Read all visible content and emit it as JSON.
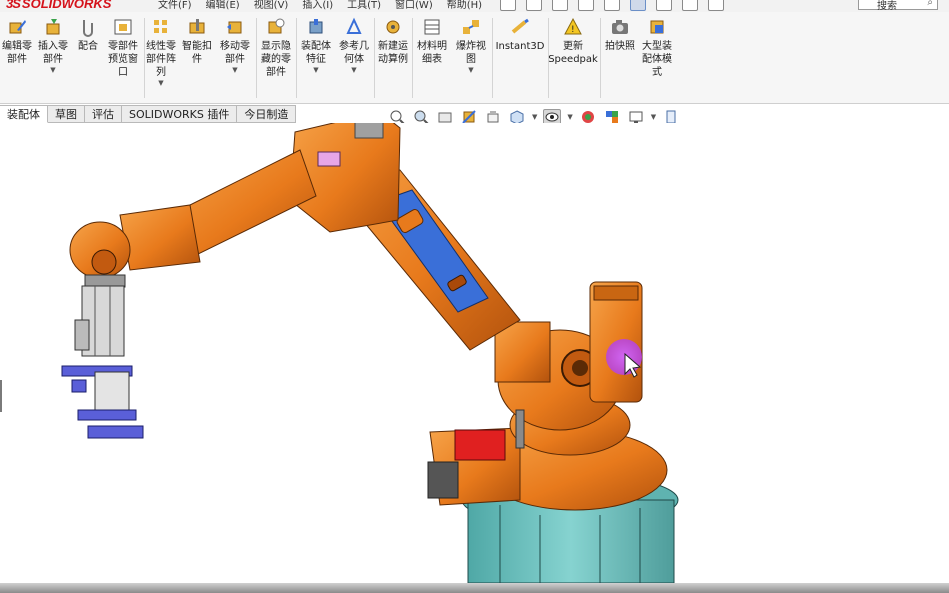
{
  "app": {
    "logo_text": "SOLIDWORKS",
    "logo_mark": "3S",
    "brand_color": "#d5121b"
  },
  "menu": {
    "items": [
      "文件(F)",
      "编辑(E)",
      "视图(V)",
      "插入(I)",
      "工具(T)",
      "窗口(W)",
      "帮助(H)"
    ],
    "search_placeholder": "搜索"
  },
  "ribbon": {
    "buttons": [
      {
        "label": "编辑零\n部件",
        "icon": "edit-component-icon",
        "dropdown": false
      },
      {
        "label": "插入零\n部件",
        "icon": "insert-component-icon",
        "dropdown": true
      },
      {
        "label": "配合",
        "icon": "mate-icon",
        "dropdown": false
      },
      {
        "label": "零部件\n预览窗\n口",
        "icon": "component-preview-icon",
        "dropdown": false
      },
      {
        "label": "线性零\n部件阵\n列",
        "icon": "linear-pattern-icon",
        "dropdown": true
      },
      {
        "label": "智能扣\n件",
        "icon": "smart-fasteners-icon",
        "dropdown": false
      },
      {
        "label": "移动零\n部件",
        "icon": "move-component-icon",
        "dropdown": true
      },
      {
        "label": "显示隐\n藏的零\n部件",
        "icon": "show-hidden-icon",
        "dropdown": false
      },
      {
        "label": "装配体\n特征",
        "icon": "assembly-feature-icon",
        "dropdown": true
      },
      {
        "label": "参考几\n何体",
        "icon": "reference-geometry-icon",
        "dropdown": true
      },
      {
        "label": "新建运\n动算例",
        "icon": "new-motion-study-icon",
        "dropdown": false
      },
      {
        "label": "材料明\n细表",
        "icon": "bill-of-materials-icon",
        "dropdown": false
      },
      {
        "label": "爆炸视\n图",
        "icon": "exploded-view-icon",
        "dropdown": true
      },
      {
        "label": "Instant3D",
        "icon": "instant3d-icon",
        "dropdown": false
      },
      {
        "label": "更新\nSpeedpak",
        "icon": "speedpak-icon",
        "dropdown": false
      },
      {
        "label": "拍快照",
        "icon": "snapshot-icon",
        "dropdown": false
      },
      {
        "label": "大型装\n配体模\n式",
        "icon": "large-assembly-icon",
        "dropdown": false
      }
    ]
  },
  "tabs": [
    {
      "label": "装配体",
      "active": true
    },
    {
      "label": "草图",
      "active": false
    },
    {
      "label": "评估",
      "active": false
    },
    {
      "label": "SOLIDWORKS 插件",
      "active": false
    },
    {
      "label": "今日制造",
      "active": false
    }
  ],
  "hud_tools": [
    "zoom-to-fit-icon",
    "zoom-area-icon",
    "previous-view-icon",
    "section-view-icon",
    "dynamic-annotation-icon",
    "view-orientation-icon",
    "display-style-icon",
    "hide-show-items-icon",
    "edit-appearance-icon",
    "apply-scene-icon",
    "view-settings-icon",
    "display-pane-icon"
  ],
  "colors": {
    "robot_orange": "#e87a1c",
    "robot_shadow": "#a9490a",
    "arm_blue": "#3a6fd8",
    "base_teal": "#76c9c6",
    "gripper_purple": "#5a5fd8",
    "cursor_highlight": "#b542e6"
  }
}
